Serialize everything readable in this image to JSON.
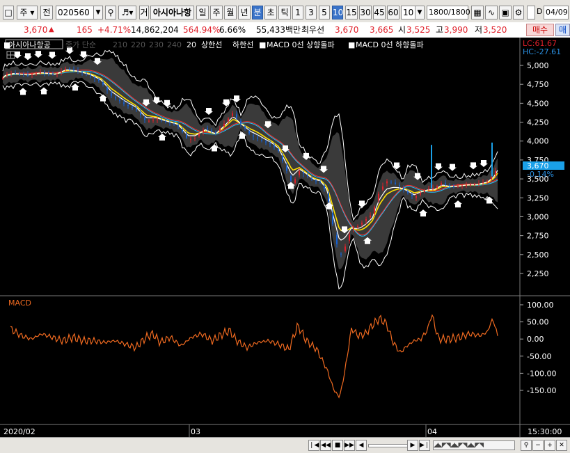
{
  "toolbar": {
    "market": "주",
    "category": "전",
    "code": "020560",
    "type_label": "거",
    "stock_name": "아시아나항",
    "periods": [
      "일",
      "주",
      "월",
      "년",
      "분",
      "초",
      "틱"
    ],
    "period_selected": "분",
    "intervals": [
      "1",
      "3",
      "5",
      "10",
      "15",
      "30",
      "45",
      "60"
    ],
    "interval_selected": "10",
    "interval_dropdown": "10",
    "count": "1800",
    "count_total": "/1800",
    "checkbox_label": "D",
    "date": "04/09"
  },
  "quote": {
    "price": "3,670",
    "change": "165",
    "change_pct": "+4.71%",
    "volume": "14,862,204",
    "volume_ratio": "564.94%",
    "turnover": "6.66%",
    "amount": "55,433백만",
    "priority_label": "최우선",
    "priority_sell": "3,670",
    "priority_buy": "3,665",
    "open_label": "시",
    "open": "3,525",
    "high_label": "고",
    "high": "3,990",
    "low_label": "저",
    "low": "3,520",
    "buy_button": "매수",
    "sell_button": "매"
  },
  "legend": {
    "name": "아시아나항공",
    "ma_label": "종가 단순",
    "ma_values": [
      "210",
      "220",
      "230",
      "240",
      "20"
    ],
    "upper": "상한선",
    "lower": "하한선",
    "macd_up": "MACD 0선 상향돌파",
    "macd_down": "MACD 0선 하향돌파"
  },
  "readout": {
    "lc": "LC:61.67",
    "hc": "HC:-27.61"
  },
  "price_tag": {
    "value": "3,670",
    "pct": "-0.14%"
  },
  "macd_label": "MACD",
  "time_axis": {
    "labels": [
      "2020/02",
      "03",
      "04"
    ],
    "clock": "15:30:00"
  },
  "colors": {
    "up": "#e0202a",
    "down": "#1560d0",
    "macd": "#f06a20",
    "axis": "#ffffff",
    "bg": "#000000"
  },
  "chart_data": [
    {
      "type": "candlestick",
      "title": "",
      "y_ticks": [
        5000,
        4750,
        4500,
        4250,
        4000,
        3750,
        3500,
        3250,
        3000,
        2750,
        2500,
        2250
      ],
      "ylim": [
        2100,
        5150
      ],
      "x_labels": [
        "2020/02",
        "03",
        "04"
      ],
      "close_path": [
        [
          0,
          4780
        ],
        [
          8,
          4880
        ],
        [
          20,
          4900
        ],
        [
          40,
          4870
        ],
        [
          60,
          4910
        ],
        [
          80,
          4880
        ],
        [
          95,
          4960
        ],
        [
          110,
          4930
        ],
        [
          130,
          4860
        ],
        [
          145,
          4780
        ],
        [
          160,
          4600
        ],
        [
          180,
          4480
        ],
        [
          195,
          4420
        ],
        [
          210,
          4260
        ],
        [
          225,
          4290
        ],
        [
          240,
          4250
        ],
        [
          255,
          4210
        ],
        [
          270,
          4020
        ],
        [
          280,
          4040
        ],
        [
          295,
          4170
        ],
        [
          310,
          4100
        ],
        [
          325,
          4260
        ],
        [
          335,
          4380
        ],
        [
          345,
          4240
        ],
        [
          360,
          4080
        ],
        [
          375,
          4010
        ],
        [
          390,
          3950
        ],
        [
          400,
          3870
        ],
        [
          410,
          3650
        ],
        [
          420,
          3430
        ],
        [
          430,
          3600
        ],
        [
          440,
          3550
        ],
        [
          450,
          3480
        ],
        [
          460,
          3460
        ],
        [
          470,
          3300
        ],
        [
          480,
          2800
        ],
        [
          488,
          2470
        ],
        [
          495,
          2580
        ],
        [
          505,
          2840
        ],
        [
          515,
          2880
        ],
        [
          525,
          2960
        ],
        [
          535,
          3040
        ],
        [
          545,
          3330
        ],
        [
          555,
          3470
        ],
        [
          565,
          3450
        ],
        [
          575,
          3400
        ],
        [
          585,
          3320
        ],
        [
          595,
          3250
        ],
        [
          605,
          3320
        ],
        [
          615,
          3370
        ],
        [
          625,
          3380
        ],
        [
          635,
          3450
        ],
        [
          645,
          3410
        ],
        [
          655,
          3400
        ],
        [
          670,
          3420
        ],
        [
          685,
          3430
        ],
        [
          700,
          3470
        ],
        [
          710,
          3560
        ],
        [
          715,
          3670
        ]
      ]
    },
    {
      "type": "line",
      "title": "MACD",
      "y_ticks": [
        100,
        50,
        0,
        -50,
        -100,
        -150
      ],
      "ylim": [
        -175,
        115
      ],
      "series": [
        {
          "points": [
            [
              15,
              30
            ],
            [
              30,
              10
            ],
            [
              45,
              0
            ],
            [
              60,
              15
            ],
            [
              75,
              5
            ],
            [
              90,
              -5
            ],
            [
              105,
              5
            ],
            [
              120,
              -5
            ],
            [
              135,
              -5
            ],
            [
              150,
              -10
            ],
            [
              165,
              -5
            ],
            [
              180,
              -15
            ],
            [
              195,
              -25
            ],
            [
              210,
              5
            ],
            [
              220,
              15
            ],
            [
              230,
              -10
            ],
            [
              245,
              5
            ],
            [
              260,
              -20
            ],
            [
              275,
              5
            ],
            [
              290,
              15
            ],
            [
              305,
              -5
            ],
            [
              320,
              15
            ],
            [
              330,
              25
            ],
            [
              340,
              -5
            ],
            [
              355,
              -25
            ],
            [
              370,
              -10
            ],
            [
              385,
              -5
            ],
            [
              400,
              -15
            ],
            [
              415,
              -30
            ],
            [
              428,
              40
            ],
            [
              440,
              -5
            ],
            [
              455,
              -30
            ],
            [
              470,
              -90
            ],
            [
              480,
              -150
            ],
            [
              488,
              -170
            ],
            [
              495,
              -100
            ],
            [
              505,
              30
            ],
            [
              515,
              10
            ],
            [
              525,
              15
            ],
            [
              535,
              40
            ],
            [
              545,
              60
            ],
            [
              555,
              45
            ],
            [
              565,
              -10
            ],
            [
              575,
              -40
            ],
            [
              585,
              -20
            ],
            [
              595,
              -5
            ],
            [
              605,
              0
            ],
            [
              615,
              30
            ],
            [
              620,
              75
            ],
            [
              630,
              0
            ],
            [
              645,
              0
            ],
            [
              660,
              5
            ],
            [
              675,
              15
            ],
            [
              690,
              10
            ],
            [
              700,
              20
            ],
            [
              708,
              60
            ],
            [
              715,
              10
            ]
          ]
        }
      ]
    }
  ]
}
